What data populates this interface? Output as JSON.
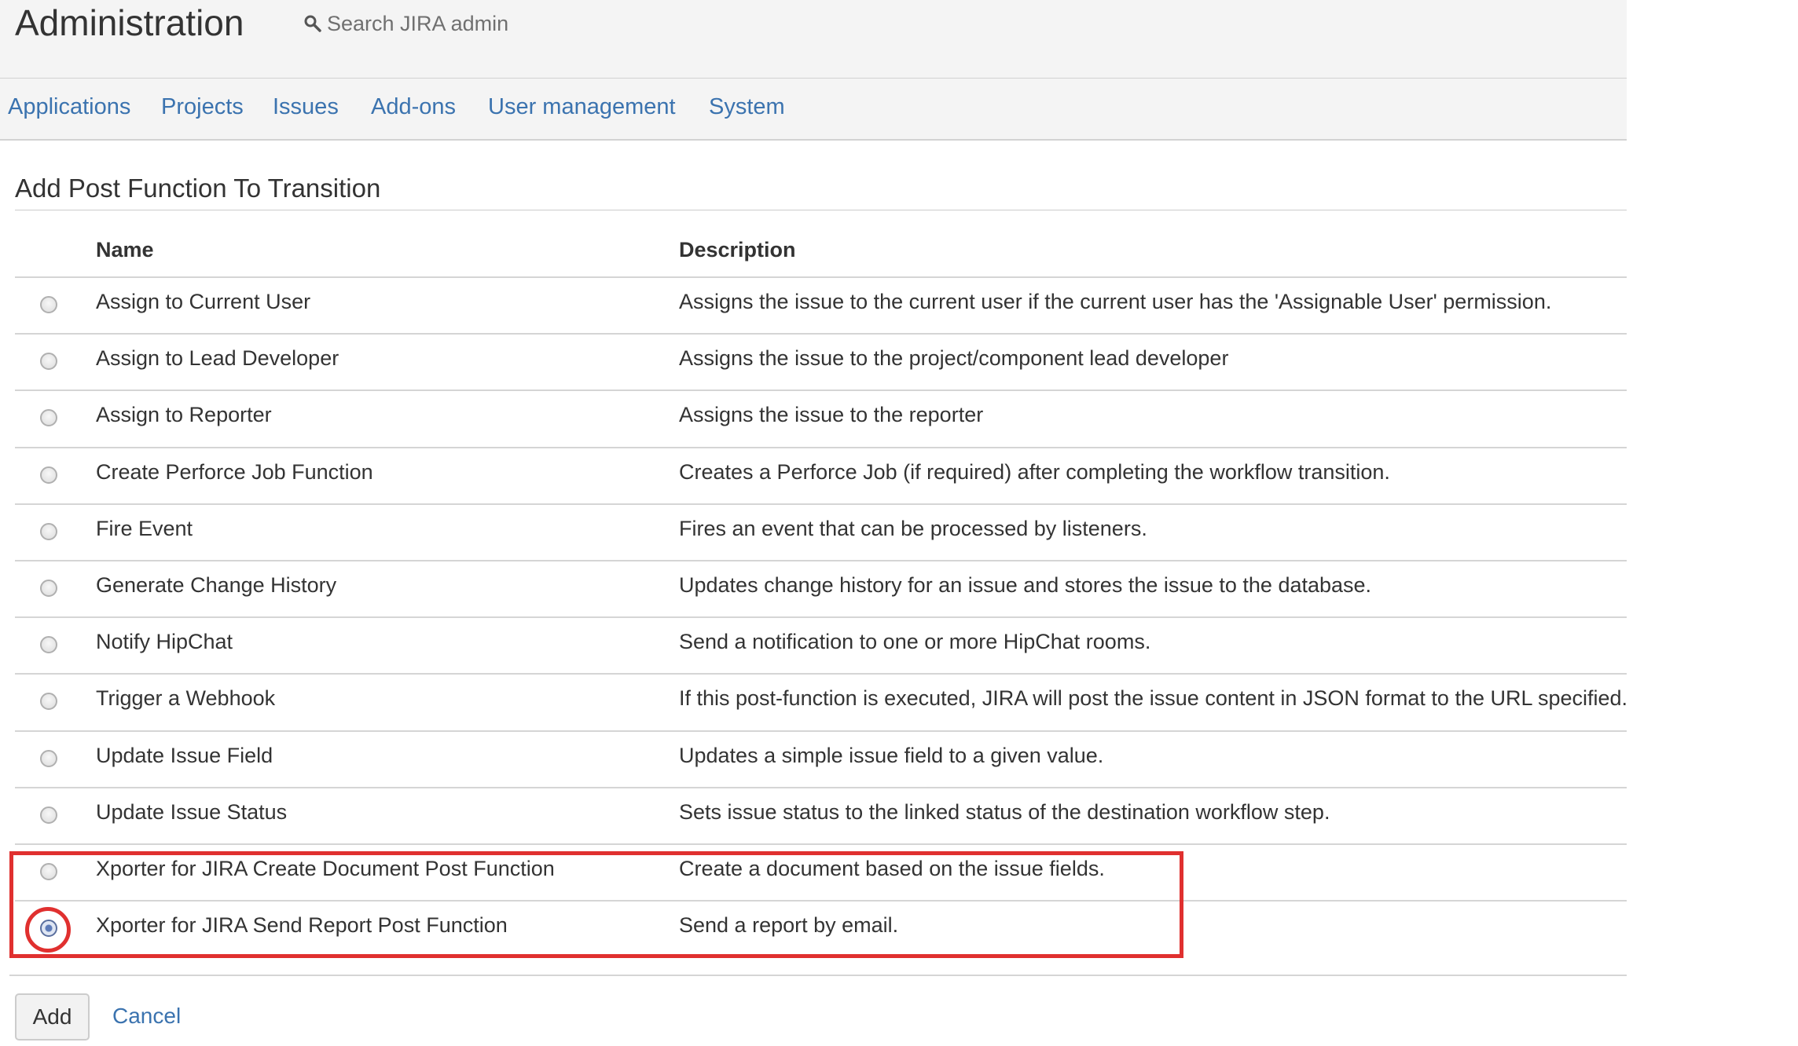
{
  "header": {
    "title": "Administration",
    "search_placeholder": "Search JIRA admin",
    "search_icon": "magnifier"
  },
  "nav": {
    "items": [
      {
        "label": "Applications"
      },
      {
        "label": "Projects"
      },
      {
        "label": "Issues"
      },
      {
        "label": "Add-ons"
      },
      {
        "label": "User management"
      },
      {
        "label": "System"
      }
    ]
  },
  "page": {
    "title": "Add Post Function To Transition"
  },
  "table": {
    "columns": [
      "Name",
      "Description"
    ],
    "selected_index": 11,
    "rows": [
      {
        "name": "Assign to Current User",
        "description": "Assigns the issue to the current user if the current user has the 'Assignable User' permission."
      },
      {
        "name": "Assign to Lead Developer",
        "description": "Assigns the issue to the project/component lead developer"
      },
      {
        "name": "Assign to Reporter",
        "description": "Assigns the issue to the reporter"
      },
      {
        "name": "Create Perforce Job Function",
        "description": "Creates a Perforce Job (if required) after completing the workflow transition."
      },
      {
        "name": "Fire Event",
        "description": "Fires an event that can be processed by listeners."
      },
      {
        "name": "Generate Change History",
        "description": "Updates change history for an issue and stores the issue to the database."
      },
      {
        "name": "Notify HipChat",
        "description": "Send a notification to one or more HipChat rooms."
      },
      {
        "name": "Trigger a Webhook",
        "description": "If this post-function is executed, JIRA will post the issue content in JSON format to the URL specified."
      },
      {
        "name": "Update Issue Field",
        "description": "Updates a simple issue field to a given value."
      },
      {
        "name": "Update Issue Status",
        "description": "Sets issue status to the linked status of the destination workflow step."
      },
      {
        "name": "Xporter for JIRA Create Document Post Function",
        "description": "Create a document based on the issue fields."
      },
      {
        "name": "Xporter for JIRA Send Report Post Function",
        "description": "Send a report by email."
      }
    ]
  },
  "actions": {
    "add_label": "Add",
    "cancel_label": "Cancel"
  },
  "colors": {
    "link": "#3b73af",
    "annotation": "#e0302f",
    "header_bg": "#f4f4f4"
  }
}
